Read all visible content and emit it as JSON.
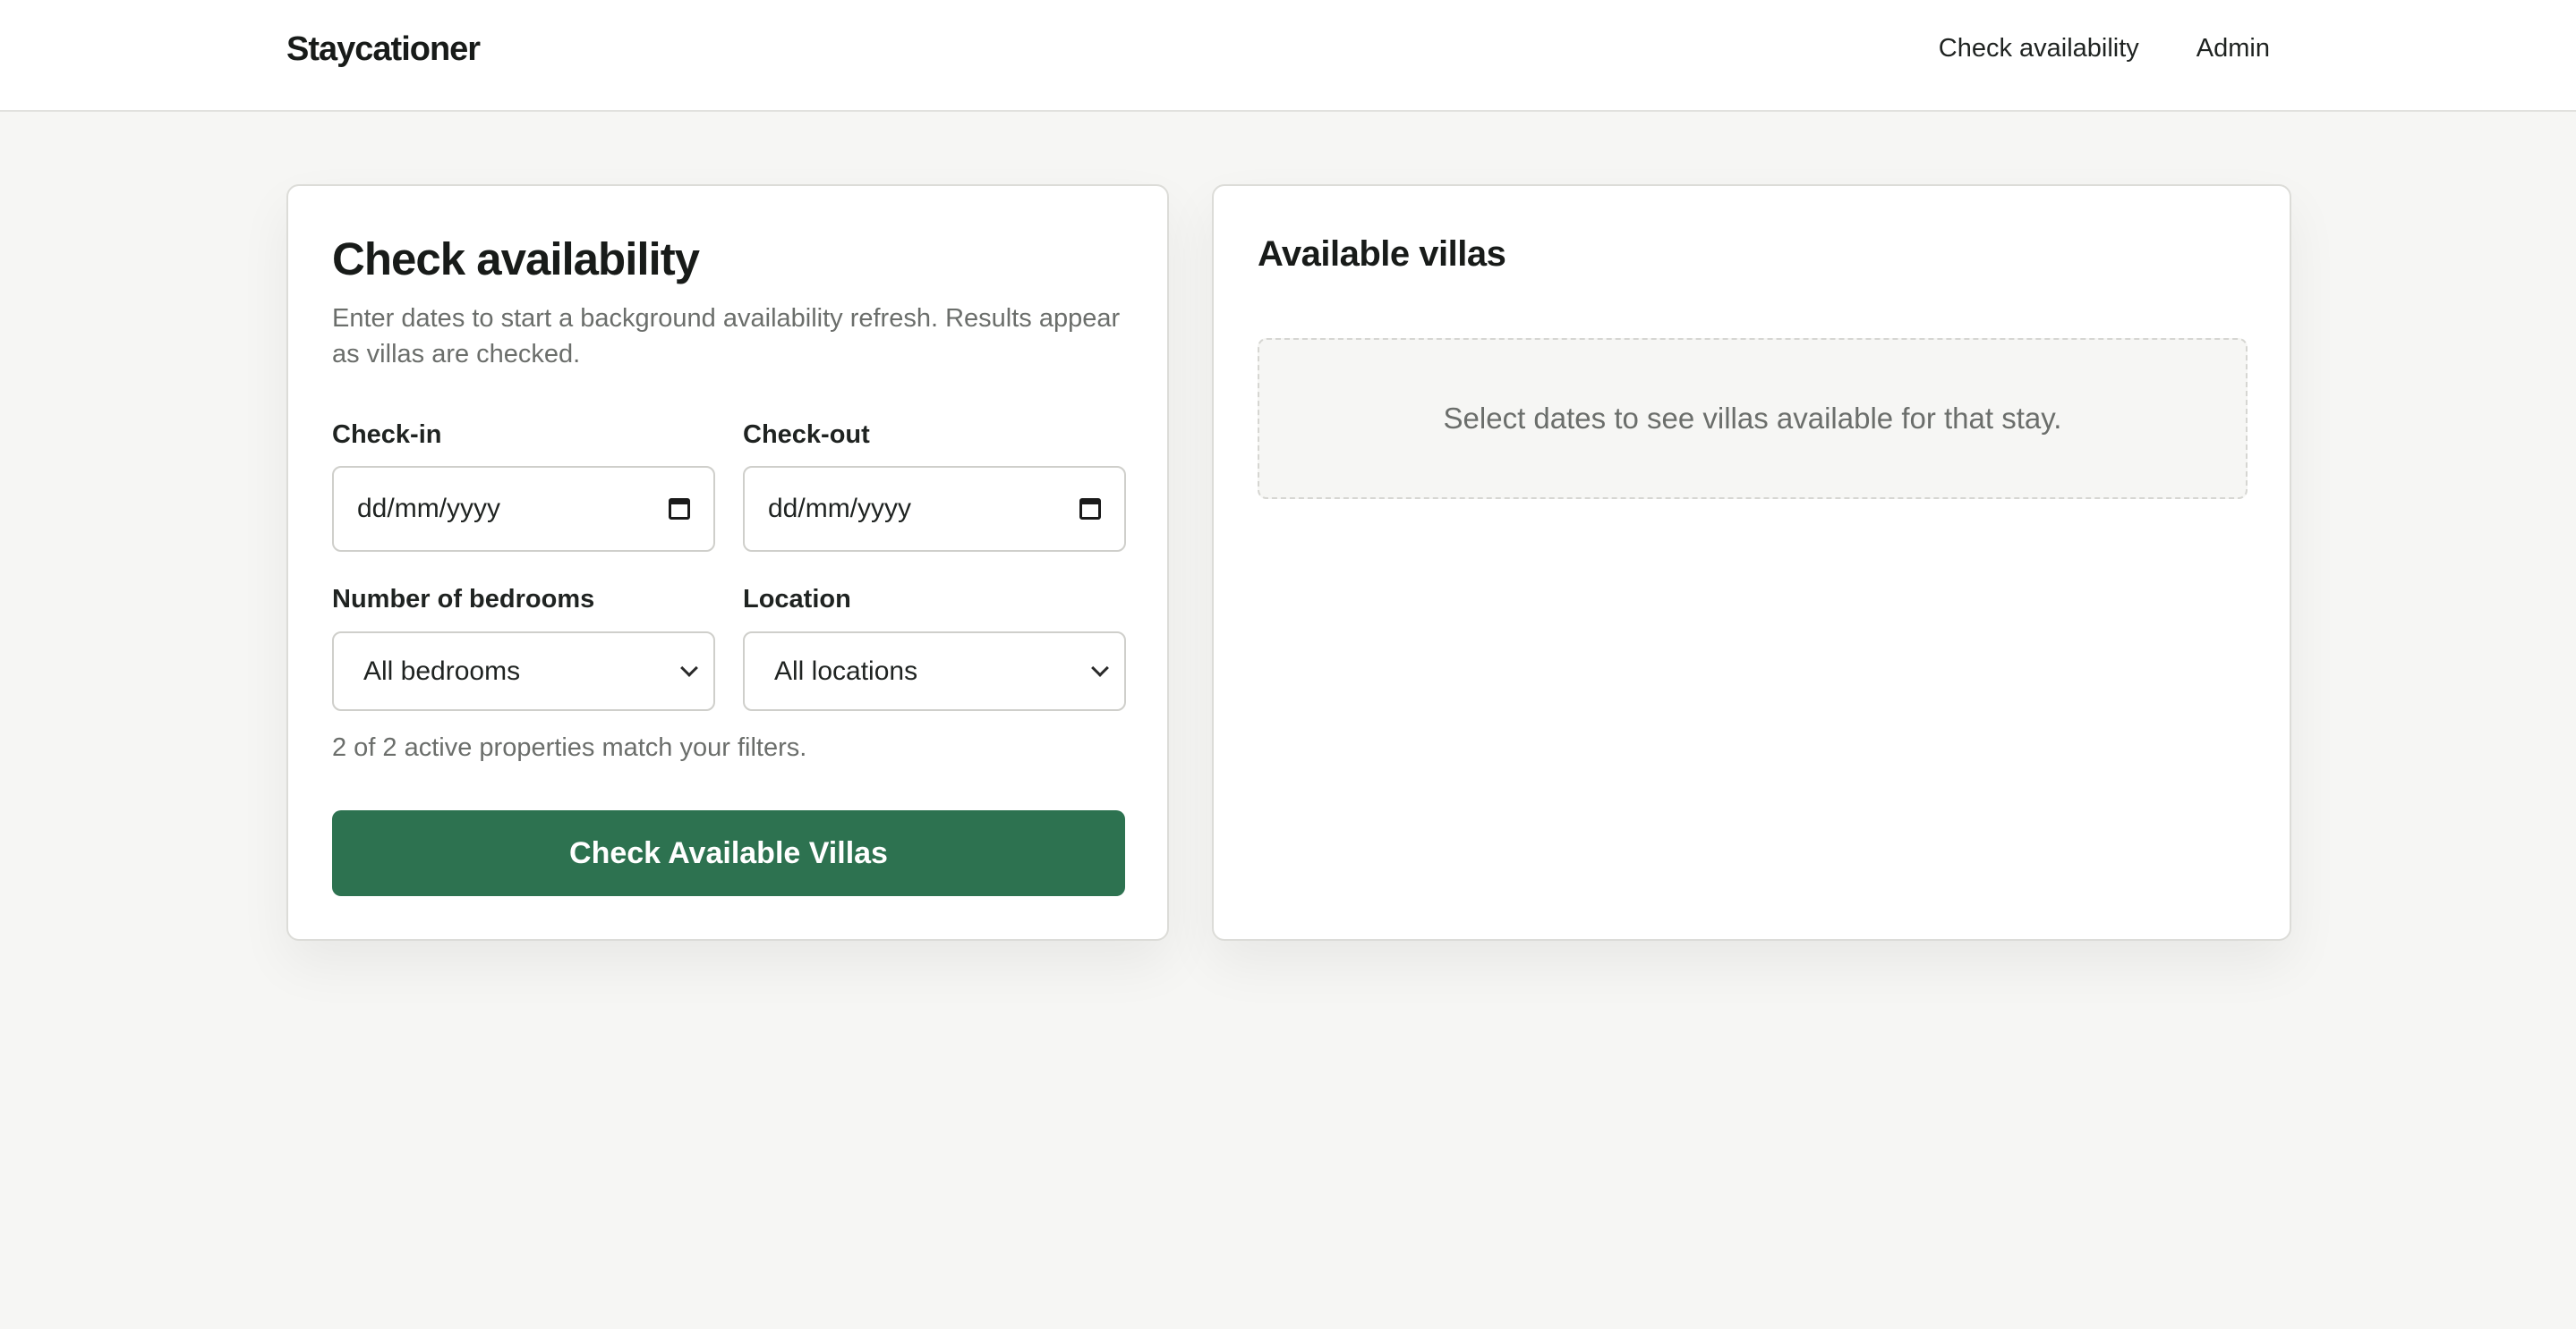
{
  "header": {
    "brand": "Staycationer",
    "nav": {
      "check_availability": "Check availability",
      "admin": "Admin"
    }
  },
  "form": {
    "title": "Check availability",
    "description": "Enter dates to start a background availability refresh. Results appear as villas are checked.",
    "checkin": {
      "label": "Check-in",
      "value": "dd/mm/yyyy",
      "icon": "calendar-icon"
    },
    "checkout": {
      "label": "Check-out",
      "value": "dd/mm/yyyy",
      "icon": "calendar-icon"
    },
    "bedrooms": {
      "label": "Number of bedrooms",
      "selected": "All bedrooms",
      "icon": "chevron-down-icon"
    },
    "location": {
      "label": "Location",
      "selected": "All locations",
      "icon": "chevron-down-icon"
    },
    "match_text": "2 of 2 active properties match your filters.",
    "submit_label": "Check Available Villas"
  },
  "results": {
    "title": "Available villas",
    "empty_message": "Select dates to see villas available for that stay."
  },
  "colors": {
    "accent": "#2d7250",
    "background": "#f6f6f4",
    "card": "#ffffff"
  }
}
